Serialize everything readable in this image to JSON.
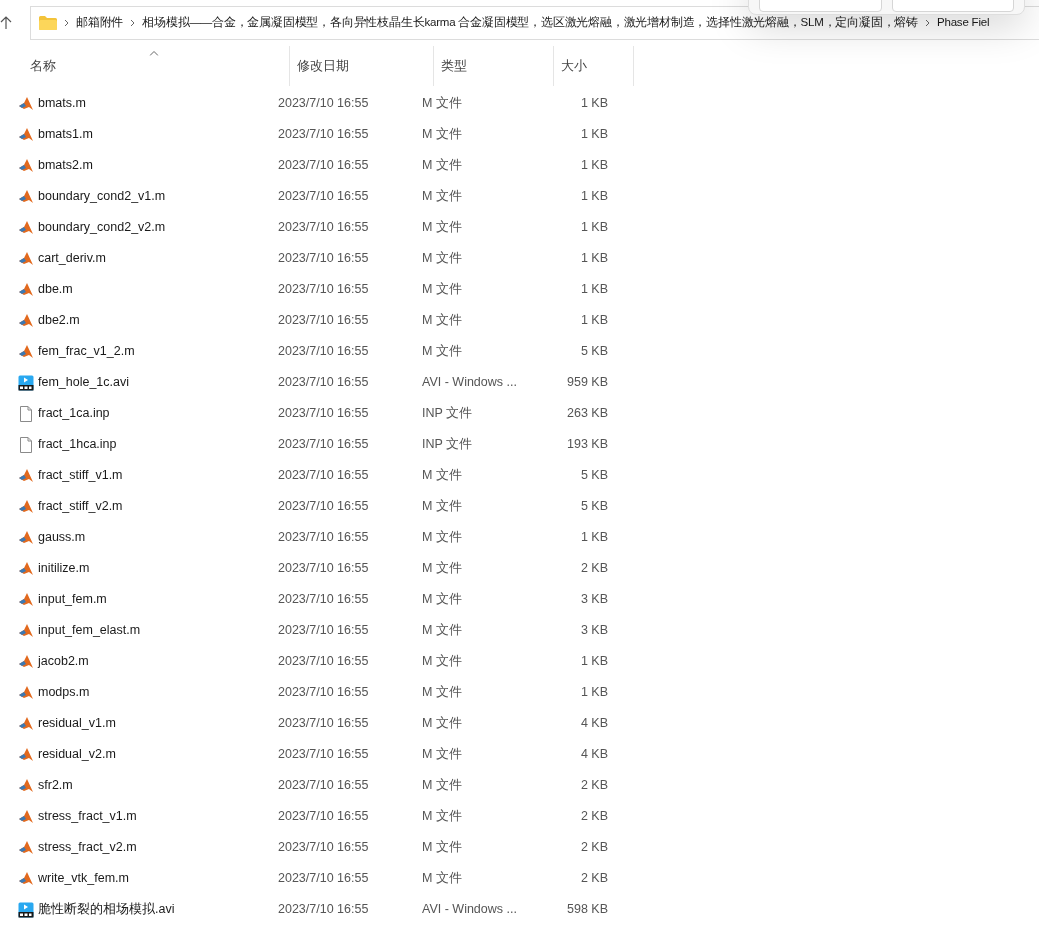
{
  "breadcrumb": [
    "邮箱附件",
    "相场模拟——合金，金属凝固模型，各向异性枝晶生长karma  合金凝固模型，选区激光熔融，激光增材制造，选择性激光熔融，SLM，定向凝固，熔铸",
    "Phase Fiel"
  ],
  "columns": [
    {
      "label": "名称",
      "sorted": true
    },
    {
      "label": "修改日期",
      "sorted": false
    },
    {
      "label": "类型",
      "sorted": false
    },
    {
      "label": "大小",
      "sorted": false
    }
  ],
  "files": [
    {
      "name": "bmats.m",
      "date": "2023/7/10 16:55",
      "type": "M 文件",
      "size": "1 KB",
      "kind": "matlab"
    },
    {
      "name": "bmats1.m",
      "date": "2023/7/10 16:55",
      "type": "M 文件",
      "size": "1 KB",
      "kind": "matlab"
    },
    {
      "name": "bmats2.m",
      "date": "2023/7/10 16:55",
      "type": "M 文件",
      "size": "1 KB",
      "kind": "matlab"
    },
    {
      "name": "boundary_cond2_v1.m",
      "date": "2023/7/10 16:55",
      "type": "M 文件",
      "size": "1 KB",
      "kind": "matlab"
    },
    {
      "name": "boundary_cond2_v2.m",
      "date": "2023/7/10 16:55",
      "type": "M 文件",
      "size": "1 KB",
      "kind": "matlab"
    },
    {
      "name": "cart_deriv.m",
      "date": "2023/7/10 16:55",
      "type": "M 文件",
      "size": "1 KB",
      "kind": "matlab"
    },
    {
      "name": "dbe.m",
      "date": "2023/7/10 16:55",
      "type": "M 文件",
      "size": "1 KB",
      "kind": "matlab"
    },
    {
      "name": "dbe2.m",
      "date": "2023/7/10 16:55",
      "type": "M 文件",
      "size": "1 KB",
      "kind": "matlab"
    },
    {
      "name": "fem_frac_v1_2.m",
      "date": "2023/7/10 16:55",
      "type": "M 文件",
      "size": "5 KB",
      "kind": "matlab"
    },
    {
      "name": "fem_hole_1c.avi",
      "date": "2023/7/10 16:55",
      "type": "AVI - Windows ...",
      "size": "959 KB",
      "kind": "video"
    },
    {
      "name": "fract_1ca.inp",
      "date": "2023/7/10 16:55",
      "type": "INP 文件",
      "size": "263 KB",
      "kind": "blank"
    },
    {
      "name": "fract_1hca.inp",
      "date": "2023/7/10 16:55",
      "type": "INP 文件",
      "size": "193 KB",
      "kind": "blank"
    },
    {
      "name": "fract_stiff_v1.m",
      "date": "2023/7/10 16:55",
      "type": "M 文件",
      "size": "5 KB",
      "kind": "matlab"
    },
    {
      "name": "fract_stiff_v2.m",
      "date": "2023/7/10 16:55",
      "type": "M 文件",
      "size": "5 KB",
      "kind": "matlab"
    },
    {
      "name": "gauss.m",
      "date": "2023/7/10 16:55",
      "type": "M 文件",
      "size": "1 KB",
      "kind": "matlab"
    },
    {
      "name": "initilize.m",
      "date": "2023/7/10 16:55",
      "type": "M 文件",
      "size": "2 KB",
      "kind": "matlab"
    },
    {
      "name": "input_fem.m",
      "date": "2023/7/10 16:55",
      "type": "M 文件",
      "size": "3 KB",
      "kind": "matlab"
    },
    {
      "name": "input_fem_elast.m",
      "date": "2023/7/10 16:55",
      "type": "M 文件",
      "size": "3 KB",
      "kind": "matlab"
    },
    {
      "name": "jacob2.m",
      "date": "2023/7/10 16:55",
      "type": "M 文件",
      "size": "1 KB",
      "kind": "matlab"
    },
    {
      "name": "modps.m",
      "date": "2023/7/10 16:55",
      "type": "M 文件",
      "size": "1 KB",
      "kind": "matlab"
    },
    {
      "name": "residual_v1.m",
      "date": "2023/7/10 16:55",
      "type": "M 文件",
      "size": "4 KB",
      "kind": "matlab"
    },
    {
      "name": "residual_v2.m",
      "date": "2023/7/10 16:55",
      "type": "M 文件",
      "size": "4 KB",
      "kind": "matlab"
    },
    {
      "name": "sfr2.m",
      "date": "2023/7/10 16:55",
      "type": "M 文件",
      "size": "2 KB",
      "kind": "matlab"
    },
    {
      "name": "stress_fract_v1.m",
      "date": "2023/7/10 16:55",
      "type": "M 文件",
      "size": "2 KB",
      "kind": "matlab"
    },
    {
      "name": "stress_fract_v2.m",
      "date": "2023/7/10 16:55",
      "type": "M 文件",
      "size": "2 KB",
      "kind": "matlab"
    },
    {
      "name": "write_vtk_fem.m",
      "date": "2023/7/10 16:55",
      "type": "M 文件",
      "size": "2 KB",
      "kind": "matlab"
    },
    {
      "name": "脆性断裂的相场模拟.avi",
      "date": "2023/7/10 16:55",
      "type": "AVI - Windows ...",
      "size": "598 KB",
      "kind": "video"
    }
  ]
}
